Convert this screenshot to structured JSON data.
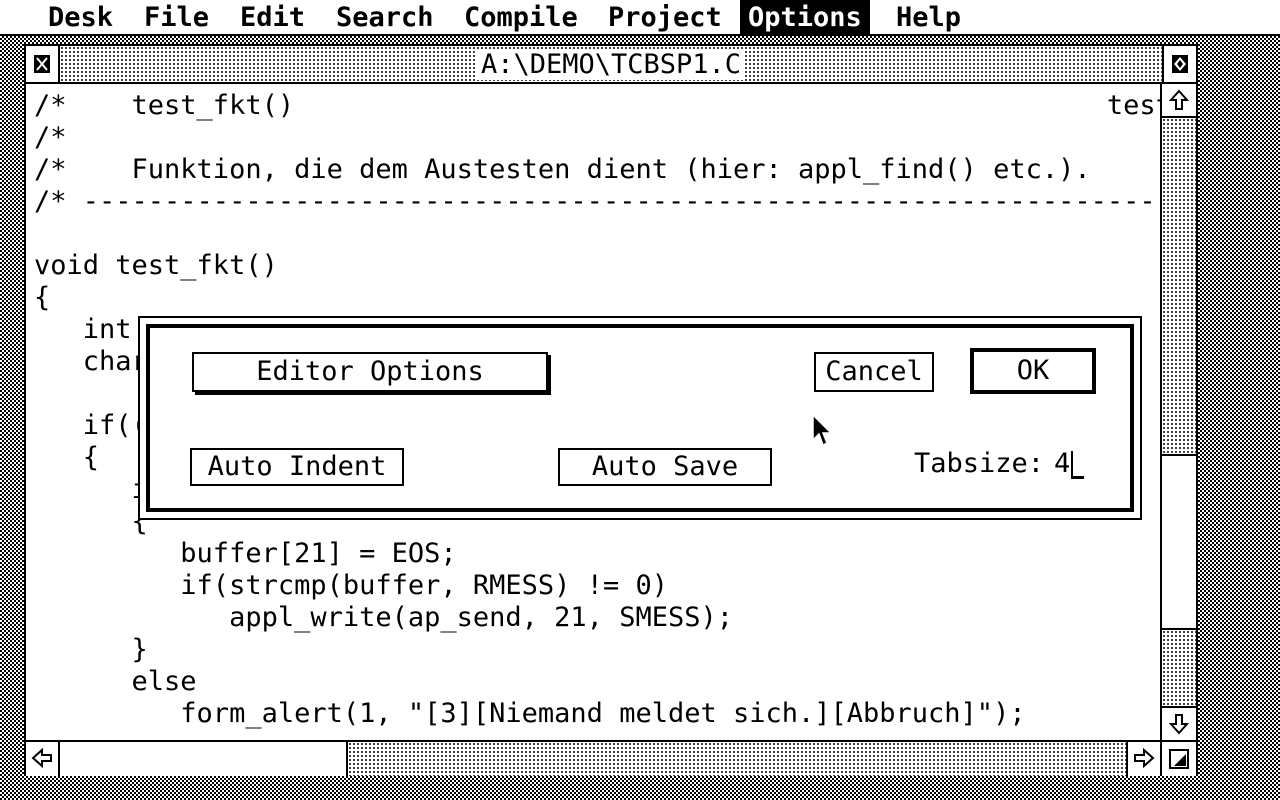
{
  "menubar": {
    "items": [
      "Desk",
      "File",
      "Edit",
      "Search",
      "Compile",
      "Project",
      "Options",
      "Help"
    ],
    "active": "Options"
  },
  "window": {
    "title": "A:\\DEMO\\TCBSP1.C"
  },
  "editor": {
    "lines": [
      "/*    test_fkt()                                                  test functio",
      "/*",
      "/*    Funktion, die dem Austesten dient (hier: appl_find() etc.).",
      "/* -----------------------------------------------------------------------------",
      "",
      "void test_fkt()",
      "{",
      "   int",
      "   char",
      "",
      "   if((",
      "   {",
      "      i",
      "      {",
      "         buffer[21] = EOS;",
      "         if(strcmp(buffer, RMESS) != 0)",
      "            appl_write(ap_send, 21, SMESS);",
      "      }",
      "      else",
      "         form_alert(1, \"[3][Niemand meldet sich.][Abbruch]\");"
    ]
  },
  "dialog": {
    "title_button": "Editor Options",
    "cancel_label": "Cancel",
    "ok_label": "OK",
    "auto_indent_label": "Auto Indent",
    "auto_save_label": "Auto Save",
    "tabsize_label": "Tabsize:",
    "tabsize_value": "4"
  },
  "icons": {
    "close": "close-icon",
    "fuller": "fuller-icon",
    "up": "arrow-up-icon",
    "down": "arrow-down-icon",
    "left": "arrow-left-icon",
    "right": "arrow-right-icon",
    "sizer": "resize-icon",
    "pointer": "mouse-pointer-icon"
  }
}
